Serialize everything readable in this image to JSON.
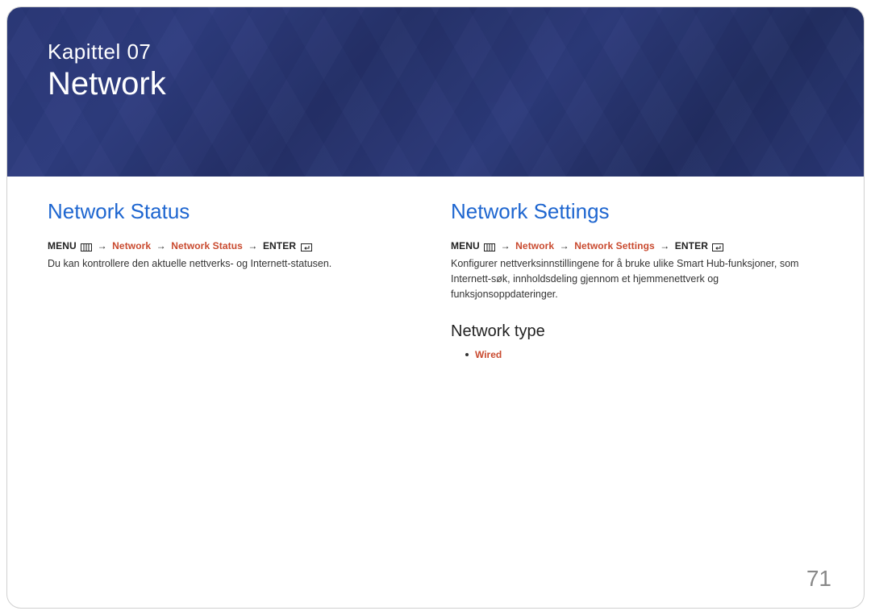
{
  "banner": {
    "chapter_label": "Kapittel  07",
    "chapter_title": "Network"
  },
  "left": {
    "heading": "Network Status",
    "path": {
      "menu": "MENU",
      "p1": "Network",
      "p2": "Network Status",
      "enter": "ENTER"
    },
    "body": "Du kan kontrollere den aktuelle nettverks- og Internett-statusen."
  },
  "right": {
    "heading": "Network Settings",
    "path": {
      "menu": "MENU",
      "p1": "Network",
      "p2": "Network Settings",
      "enter": "ENTER"
    },
    "body": "Konfigurer nettverksinnstillingene for å bruke ulike Smart Hub-funksjoner, som Internett-søk, innholdsdeling gjennom et hjemmenettverk og funksjonsoppdateringer.",
    "sub_heading": "Network type",
    "bullet": "Wired"
  },
  "page_number": "71",
  "glyphs": {
    "arrow": "→"
  }
}
